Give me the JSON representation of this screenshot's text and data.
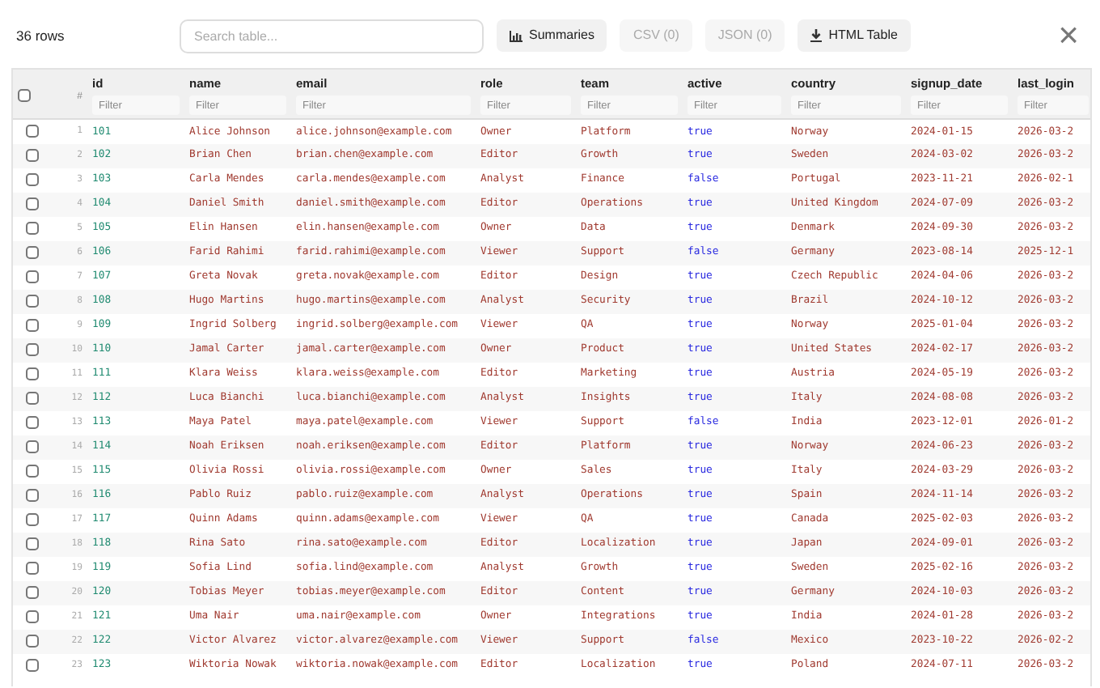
{
  "toolbar": {
    "row_count": "36 rows",
    "search": {
      "placeholder": "Search table..."
    },
    "buttons": [
      {
        "label": "Summaries",
        "kind": "chart",
        "disabled": false
      },
      {
        "label": "CSV (0)",
        "kind": "plain",
        "disabled": true
      },
      {
        "label": "JSON (0)",
        "kind": "plain",
        "disabled": true
      },
      {
        "label": "HTML Table",
        "kind": "download",
        "disabled": false
      }
    ],
    "close": "×"
  },
  "table": {
    "select_all": {
      "checked": false
    },
    "index_header": "#",
    "columns": [
      {
        "name": "id",
        "kind": "id",
        "filter_placeholder": "Filter"
      },
      {
        "name": "name",
        "kind": "text",
        "filter_placeholder": "Filter"
      },
      {
        "name": "email",
        "kind": "text",
        "filter_placeholder": "Filter"
      },
      {
        "name": "role",
        "kind": "text",
        "filter_placeholder": "Filter"
      },
      {
        "name": "team",
        "kind": "text",
        "filter_placeholder": "Filter"
      },
      {
        "name": "active",
        "kind": "bool",
        "filter_placeholder": "Filter"
      },
      {
        "name": "country",
        "kind": "text",
        "filter_placeholder": "Filter"
      },
      {
        "name": "signup_date",
        "kind": "text",
        "filter_placeholder": "Filter"
      },
      {
        "name": "last_login",
        "kind": "text",
        "filter_placeholder": "Filter"
      }
    ],
    "rows": [
      {
        "index": "1",
        "checked": false,
        "cells": [
          "101",
          "Alice Johnson",
          "alice.johnson@example.com",
          "Owner",
          "Platform",
          "true",
          "Norway",
          "2024-01-15",
          "2026-03-2"
        ]
      },
      {
        "index": "2",
        "checked": false,
        "cells": [
          "102",
          "Brian Chen",
          "brian.chen@example.com",
          "Editor",
          "Growth",
          "true",
          "Sweden",
          "2024-03-02",
          "2026-03-2"
        ]
      },
      {
        "index": "3",
        "checked": false,
        "cells": [
          "103",
          "Carla Mendes",
          "carla.mendes@example.com",
          "Analyst",
          "Finance",
          "false",
          "Portugal",
          "2023-11-21",
          "2026-02-1"
        ]
      },
      {
        "index": "4",
        "checked": false,
        "cells": [
          "104",
          "Daniel Smith",
          "daniel.smith@example.com",
          "Editor",
          "Operations",
          "true",
          "United Kingdom",
          "2024-07-09",
          "2026-03-2"
        ]
      },
      {
        "index": "5",
        "checked": false,
        "cells": [
          "105",
          "Elin Hansen",
          "elin.hansen@example.com",
          "Owner",
          "Data",
          "true",
          "Denmark",
          "2024-09-30",
          "2026-03-2"
        ]
      },
      {
        "index": "6",
        "checked": false,
        "cells": [
          "106",
          "Farid Rahimi",
          "farid.rahimi@example.com",
          "Viewer",
          "Support",
          "false",
          "Germany",
          "2023-08-14",
          "2025-12-1"
        ]
      },
      {
        "index": "7",
        "checked": false,
        "cells": [
          "107",
          "Greta Novak",
          "greta.novak@example.com",
          "Editor",
          "Design",
          "true",
          "Czech Republic",
          "2024-04-06",
          "2026-03-2"
        ]
      },
      {
        "index": "8",
        "checked": false,
        "cells": [
          "108",
          "Hugo Martins",
          "hugo.martins@example.com",
          "Analyst",
          "Security",
          "true",
          "Brazil",
          "2024-10-12",
          "2026-03-2"
        ]
      },
      {
        "index": "9",
        "checked": false,
        "cells": [
          "109",
          "Ingrid Solberg",
          "ingrid.solberg@example.com",
          "Viewer",
          "QA",
          "true",
          "Norway",
          "2025-01-04",
          "2026-03-2"
        ]
      },
      {
        "index": "10",
        "checked": false,
        "cells": [
          "110",
          "Jamal Carter",
          "jamal.carter@example.com",
          "Owner",
          "Product",
          "true",
          "United States",
          "2024-02-17",
          "2026-03-2"
        ]
      },
      {
        "index": "11",
        "checked": false,
        "cells": [
          "111",
          "Klara Weiss",
          "klara.weiss@example.com",
          "Editor",
          "Marketing",
          "true",
          "Austria",
          "2024-05-19",
          "2026-03-2"
        ]
      },
      {
        "index": "12",
        "checked": false,
        "cells": [
          "112",
          "Luca Bianchi",
          "luca.bianchi@example.com",
          "Analyst",
          "Insights",
          "true",
          "Italy",
          "2024-08-08",
          "2026-03-2"
        ]
      },
      {
        "index": "13",
        "checked": false,
        "cells": [
          "113",
          "Maya Patel",
          "maya.patel@example.com",
          "Viewer",
          "Support",
          "false",
          "India",
          "2023-12-01",
          "2026-01-2"
        ]
      },
      {
        "index": "14",
        "checked": false,
        "cells": [
          "114",
          "Noah Eriksen",
          "noah.eriksen@example.com",
          "Editor",
          "Platform",
          "true",
          "Norway",
          "2024-06-23",
          "2026-03-2"
        ]
      },
      {
        "index": "15",
        "checked": false,
        "cells": [
          "115",
          "Olivia Rossi",
          "olivia.rossi@example.com",
          "Owner",
          "Sales",
          "true",
          "Italy",
          "2024-03-29",
          "2026-03-2"
        ]
      },
      {
        "index": "16",
        "checked": false,
        "cells": [
          "116",
          "Pablo Ruiz",
          "pablo.ruiz@example.com",
          "Analyst",
          "Operations",
          "true",
          "Spain",
          "2024-11-14",
          "2026-03-2"
        ]
      },
      {
        "index": "17",
        "checked": false,
        "cells": [
          "117",
          "Quinn Adams",
          "quinn.adams@example.com",
          "Viewer",
          "QA",
          "true",
          "Canada",
          "2025-02-03",
          "2026-03-2"
        ]
      },
      {
        "index": "18",
        "checked": false,
        "cells": [
          "118",
          "Rina Sato",
          "rina.sato@example.com",
          "Editor",
          "Localization",
          "true",
          "Japan",
          "2024-09-01",
          "2026-03-2"
        ]
      },
      {
        "index": "19",
        "checked": false,
        "cells": [
          "119",
          "Sofia Lind",
          "sofia.lind@example.com",
          "Analyst",
          "Growth",
          "true",
          "Sweden",
          "2025-02-16",
          "2026-03-2"
        ]
      },
      {
        "index": "20",
        "checked": false,
        "cells": [
          "120",
          "Tobias Meyer",
          "tobias.meyer@example.com",
          "Editor",
          "Content",
          "true",
          "Germany",
          "2024-10-03",
          "2026-03-2"
        ]
      },
      {
        "index": "21",
        "checked": false,
        "cells": [
          "121",
          "Uma Nair",
          "uma.nair@example.com",
          "Owner",
          "Integrations",
          "true",
          "India",
          "2024-01-28",
          "2026-03-2"
        ]
      },
      {
        "index": "22",
        "checked": false,
        "cells": [
          "122",
          "Victor Alvarez",
          "victor.alvarez@example.com",
          "Viewer",
          "Support",
          "false",
          "Mexico",
          "2023-10-22",
          "2026-02-2"
        ]
      },
      {
        "index": "23",
        "checked": false,
        "cells": [
          "123",
          "Wiktoria Nowak",
          "wiktoria.nowak@example.com",
          "Editor",
          "Localization",
          "true",
          "Poland",
          "2024-07-11",
          "2026-03-2"
        ]
      }
    ]
  }
}
